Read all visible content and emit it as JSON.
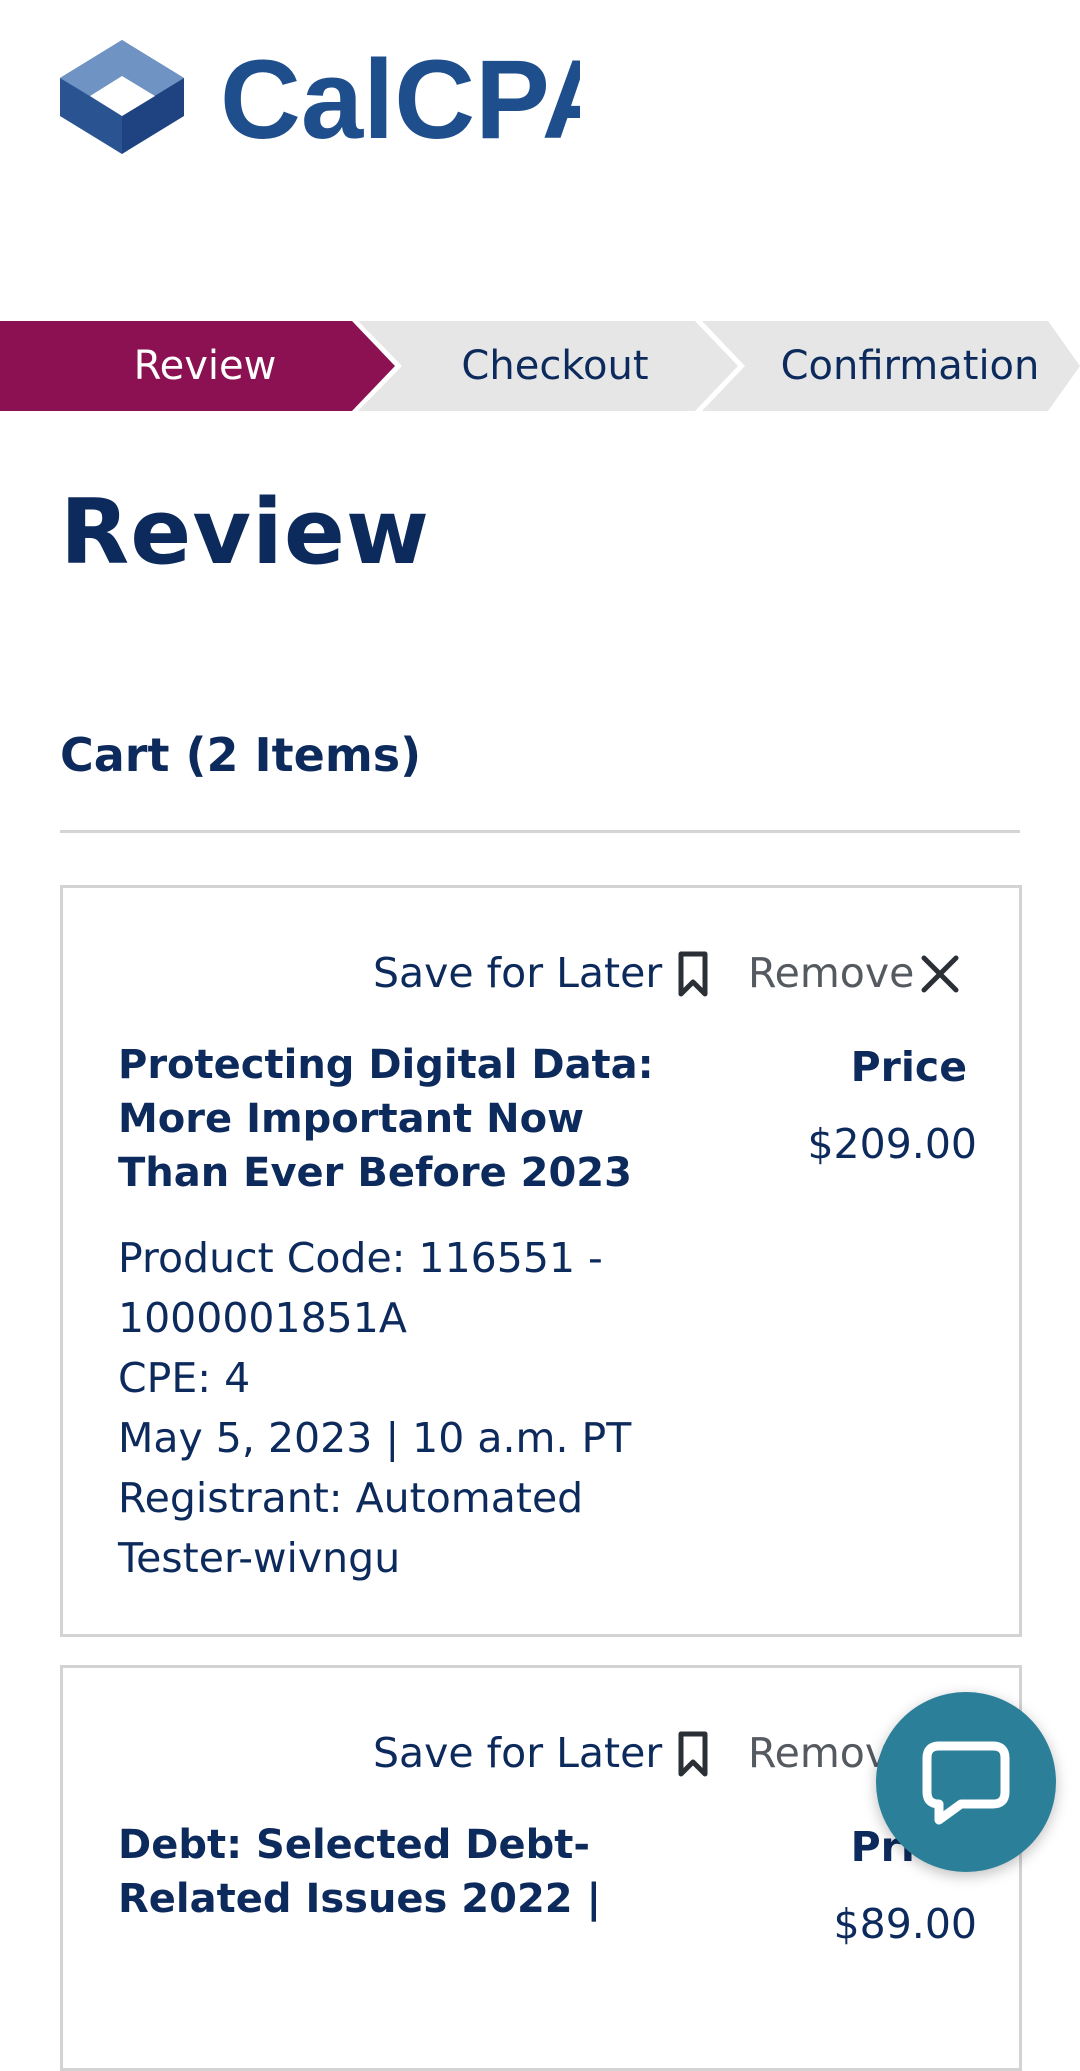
{
  "logo": {
    "text": "CalCPA"
  },
  "steps": [
    {
      "label": "Review",
      "active": true
    },
    {
      "label": "Checkout",
      "active": false
    },
    {
      "label": "Confirmation",
      "active": false
    }
  ],
  "page_title": "Review",
  "cart_heading": "Cart (2 Items)",
  "colors": {
    "brand_navy": "#0d2a5c",
    "active_step": "#8b1152",
    "inactive_step": "#e6e6e6",
    "chat_button": "#2b7f99"
  },
  "items": [
    {
      "save_label": "Save for Later",
      "remove_label": "Remove",
      "title": "Protecting Digital Data: More Important Now Than Ever Before 2023",
      "price_label": "Price",
      "price": "$209.00",
      "product_code_line1": "Product Code: 116551 -",
      "product_code_line2": "1000001851A",
      "cpe": "CPE: 4",
      "date": "May 5, 2023 | 10 a.m. PT",
      "registrant_line1": "Registrant: Automated",
      "registrant_line2": "Tester-wivngu"
    },
    {
      "save_label": "Save for Later",
      "remove_label": "Remove",
      "title": "Debt: Selected Debt-Related Issues 2022 |",
      "price_label": "Price",
      "price": "$89.00"
    }
  ],
  "icons": {
    "bookmark": "bookmark-icon",
    "remove": "close-icon",
    "chat": "chat-bubble-icon"
  }
}
